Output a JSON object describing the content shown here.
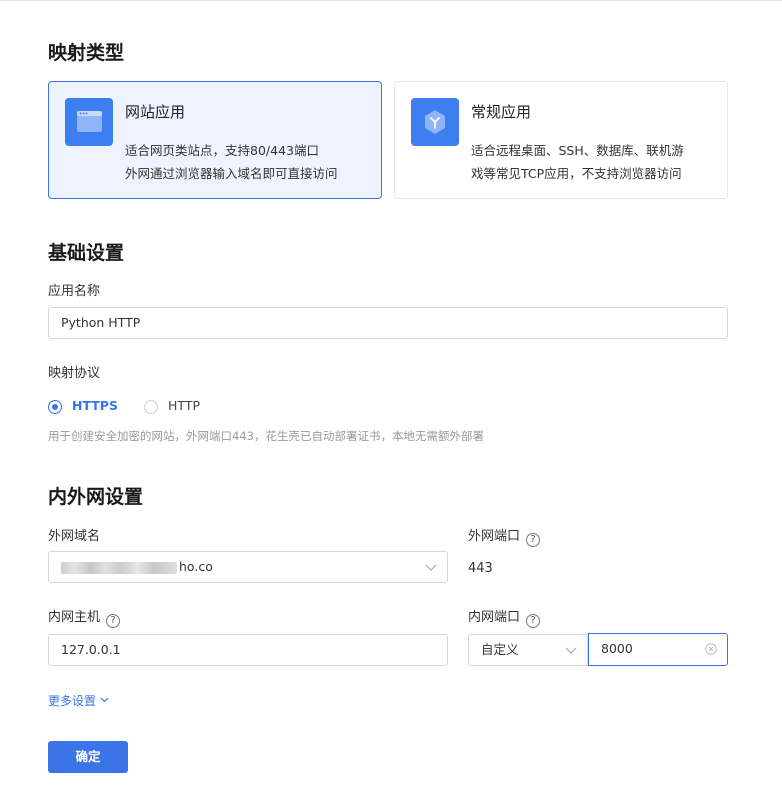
{
  "mapping_type": {
    "title": "映射类型",
    "cards": [
      {
        "title": "网站应用",
        "desc1": "适合网页类站点，支持80/443端口",
        "desc2": "外网通过浏览器输入域名即可直接访问"
      },
      {
        "title": "常规应用",
        "desc1": "适合远程桌面、SSH、数据库、联机游",
        "desc2": "戏等常见TCP应用，不支持浏览器访问"
      }
    ]
  },
  "basic": {
    "title": "基础设置",
    "app_name_label": "应用名称",
    "app_name_value": "Python HTTP",
    "protocol_label": "映射协议",
    "protocols": [
      "HTTPS",
      "HTTP"
    ],
    "selected_protocol": "HTTPS",
    "hint": "用于创建安全加密的网站，外网端口443，花生壳已自动部署证书，本地无需额外部署"
  },
  "network": {
    "title": "内外网设置",
    "domain_label": "外网域名",
    "domain_suffix": "ho.co",
    "ext_port_label": "外网端口",
    "ext_port_value": "443",
    "host_label": "内网主机",
    "host_value": "127.0.0.1",
    "int_port_label": "内网端口",
    "int_port_mode": "自定义",
    "int_port_value": "8000",
    "help_glyph": "?"
  },
  "more_label": "更多设置",
  "confirm_label": "确定",
  "colors": {
    "accent": "#3a74e6",
    "card_selected_bg": "#edf3ff"
  }
}
